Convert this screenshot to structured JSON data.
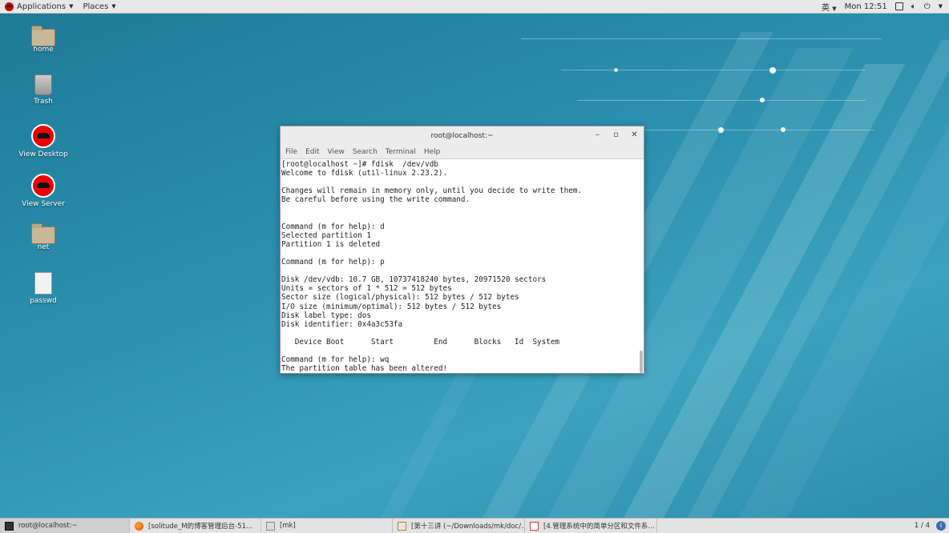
{
  "top_panel": {
    "applications": "Applications",
    "places": "Places",
    "input_method": "英",
    "clock": "Mon 12:51"
  },
  "desktop_icons": [
    {
      "label": "home"
    },
    {
      "label": "Trash"
    },
    {
      "label": "View Desktop"
    },
    {
      "label": "View Server"
    },
    {
      "label": "net"
    },
    {
      "label": "passwd"
    }
  ],
  "terminal": {
    "title": "root@localhost:~",
    "menu": [
      "File",
      "Edit",
      "View",
      "Search",
      "Terminal",
      "Help"
    ],
    "lines": [
      "[root@localhost ~]# fdisk  /dev/vdb",
      "Welcome to fdisk (util-linux 2.23.2).",
      "",
      "Changes will remain in memory only, until you decide to write them.",
      "Be careful before using the write command.",
      "",
      "",
      "Command (m for help): d",
      "Selected partition 1",
      "Partition 1 is deleted",
      "",
      "Command (m for help): p",
      "",
      "Disk /dev/vdb: 10.7 GB, 10737418240 bytes, 20971520 sectors",
      "Units = sectors of 1 * 512 = 512 bytes",
      "Sector size (logical/physical): 512 bytes / 512 bytes",
      "I/O size (minimum/optimal): 512 bytes / 512 bytes",
      "Disk label type: dos",
      "Disk identifier: 0x4a3c53fa",
      "",
      "   Device Boot      Start         End      Blocks   Id  System",
      "",
      "Command (m for help): wq",
      "The partition table has been altered!"
    ]
  },
  "taskbar": {
    "tasks": [
      {
        "label": "root@localhost:~"
      },
      {
        "label": "[solitude_M的博客管理后台-51..."
      },
      {
        "label": "[mk]"
      },
      {
        "label": "[第十三讲 (~/Downloads/mk/doc/..."
      },
      {
        "label": "[4.管理系统中的简单分区和文件系..."
      }
    ],
    "workspace": "1 / 4"
  }
}
